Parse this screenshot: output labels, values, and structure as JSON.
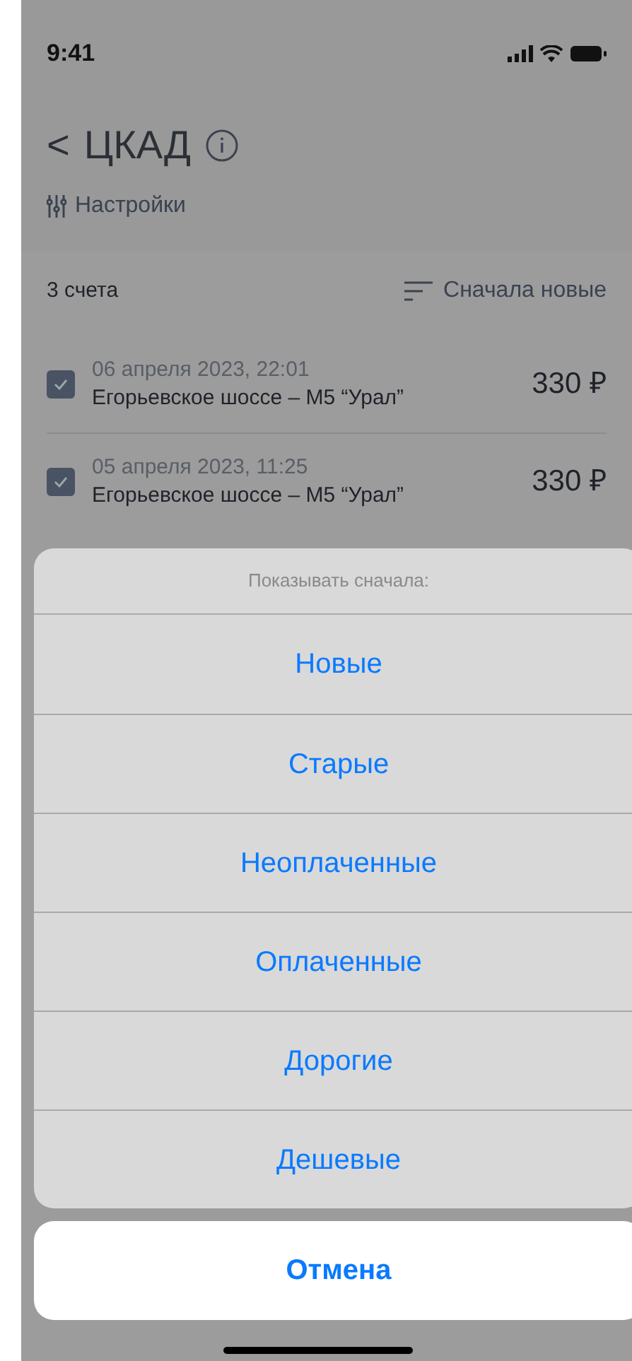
{
  "status_bar": {
    "time": "9:41"
  },
  "header": {
    "back": "<",
    "title": "ЦКАД",
    "settings": "Настройки"
  },
  "list_header": {
    "count": "3 счета",
    "sort": "Сначала новые"
  },
  "rows": [
    {
      "date": "06 апреля 2023, 22:01",
      "route": "Егорьевское шоссе – М5 “Урал”",
      "amount": "330 ₽",
      "checked": true
    },
    {
      "date": "05 апреля 2023, 11:25",
      "route": "Егорьевское шоссе – М5 “Урал”",
      "amount": "330 ₽",
      "checked": true
    }
  ],
  "action_sheet": {
    "title": "Показывать сначала:",
    "options": [
      "Новые",
      "Старые",
      "Неоплаченные",
      "Оплаченные",
      "Дорогие",
      "Дешевые"
    ],
    "cancel": "Отмена"
  }
}
